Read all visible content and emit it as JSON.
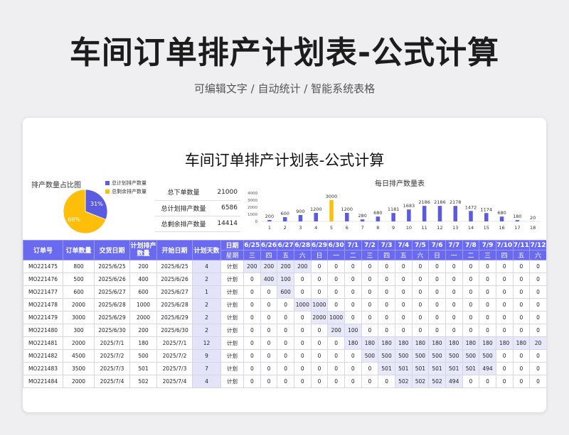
{
  "page": {
    "title": "车间订单排产计划表-公式计算",
    "subtitle": "可编辑文字 / 自动统计 / 智能系统表格"
  },
  "sheet": {
    "title": "车间订单排产计划表-公式计算",
    "pie": {
      "title": "排产数量占比图",
      "slices": [
        {
          "label": "总计划排产数量",
          "percent": "31%",
          "value": 31,
          "color": "#5b5be0"
        },
        {
          "label": "总剩余排产数量",
          "percent": "69%",
          "value": 69,
          "color": "#ffbe0a"
        }
      ]
    },
    "summary": [
      {
        "label": "总下单数量",
        "value": "21000"
      },
      {
        "label": "总计划排产数量",
        "value": "6586"
      },
      {
        "label": "总剩余排产数量",
        "value": "14414"
      }
    ]
  },
  "chart_data": {
    "type": "bar",
    "title": "每日排产数量表",
    "categories": [
      "1",
      "2",
      "3",
      "4",
      "5",
      "6",
      "7",
      "8",
      "9",
      "10",
      "11",
      "12",
      "13",
      "14",
      "15",
      "16",
      "17",
      "18"
    ],
    "values": [
      200,
      600,
      900,
      1200,
      3000,
      1200,
      280,
      680,
      1181,
      1683,
      2186,
      2186,
      2178,
      1472,
      1174,
      680,
      180,
      20
    ],
    "highlight_index": 4,
    "yticks": [
      "4000",
      "3000",
      "2000",
      "1000",
      "0"
    ],
    "ylim": [
      0,
      4000
    ],
    "bar_color": "#5b5be0",
    "highlight_color": "#ffbe0a"
  },
  "table": {
    "headers": {
      "order_no": "订单号",
      "qty": "订单数量",
      "due": "交货日期",
      "plan_qty": "计划排产数量",
      "start": "开始日期",
      "days": "计划天数",
      "date_label": "日期",
      "week_label": "星期"
    },
    "dates": [
      "6/25",
      "6/26",
      "6/27",
      "6/28",
      "6/29",
      "6/30",
      "7/1",
      "7/2",
      "7/3",
      "7/4",
      "7/5",
      "7/6",
      "7/7",
      "7/8",
      "7/9",
      "7/10",
      "7/11",
      "7/12"
    ],
    "weekdays": [
      "三",
      "四",
      "五",
      "六",
      "日",
      "一",
      "二",
      "三",
      "四",
      "五",
      "六",
      "日",
      "一",
      "二",
      "三",
      "四",
      "五",
      "六"
    ],
    "rows": [
      {
        "order": "MO221475",
        "qty": "800",
        "due": "2025/6/25",
        "plan": "200",
        "start": "2025/6/25",
        "days": "4",
        "type": "计划",
        "cells": [
          "200",
          "200",
          "200",
          "200",
          "0",
          "0",
          "0",
          "0",
          "0",
          "0",
          "0",
          "0",
          "0",
          "0",
          "0",
          "0",
          "0",
          "0"
        ]
      },
      {
        "order": "MO221476",
        "qty": "500",
        "due": "2025/6/26",
        "plan": "400",
        "start": "2025/6/26",
        "days": "2",
        "type": "计划",
        "cells": [
          "0",
          "400",
          "100",
          "0",
          "0",
          "0",
          "0",
          "0",
          "0",
          "0",
          "0",
          "0",
          "0",
          "0",
          "0",
          "0",
          "0",
          "0"
        ]
      },
      {
        "order": "MO221477",
        "qty": "600",
        "due": "2025/6/27",
        "plan": "600",
        "start": "2025/6/27",
        "days": "1",
        "type": "计划",
        "cells": [
          "0",
          "0",
          "600",
          "0",
          "0",
          "0",
          "0",
          "0",
          "0",
          "0",
          "0",
          "0",
          "0",
          "0",
          "0",
          "0",
          "0",
          "0"
        ]
      },
      {
        "order": "MO221478",
        "qty": "2000",
        "due": "2025/6/28",
        "plan": "1000",
        "start": "2025/6/28",
        "days": "2",
        "type": "计划",
        "cells": [
          "0",
          "0",
          "0",
          "1000",
          "1000",
          "0",
          "0",
          "0",
          "0",
          "0",
          "0",
          "0",
          "0",
          "0",
          "0",
          "0",
          "0",
          "0"
        ]
      },
      {
        "order": "MO221479",
        "qty": "3000",
        "due": "2025/6/29",
        "plan": "2000",
        "start": "2025/6/29",
        "days": "2",
        "type": "计划",
        "cells": [
          "0",
          "0",
          "0",
          "0",
          "2000",
          "1000",
          "0",
          "0",
          "0",
          "0",
          "0",
          "0",
          "0",
          "0",
          "0",
          "0",
          "0",
          "0"
        ]
      },
      {
        "order": "MO221480",
        "qty": "300",
        "due": "2025/6/30",
        "plan": "200",
        "start": "2025/6/30",
        "days": "2",
        "type": "计划",
        "cells": [
          "0",
          "0",
          "0",
          "0",
          "0",
          "200",
          "100",
          "0",
          "0",
          "0",
          "0",
          "0",
          "0",
          "0",
          "0",
          "0",
          "0",
          "0"
        ]
      },
      {
        "order": "MO221481",
        "qty": "2000",
        "due": "2025/7/1",
        "plan": "180",
        "start": "2025/7/1",
        "days": "12",
        "type": "计划",
        "cells": [
          "0",
          "0",
          "0",
          "0",
          "0",
          "0",
          "180",
          "180",
          "180",
          "180",
          "180",
          "180",
          "180",
          "180",
          "180",
          "180",
          "180",
          "20"
        ]
      },
      {
        "order": "MO221482",
        "qty": "4500",
        "due": "2025/7/2",
        "plan": "500",
        "start": "2025/7/2",
        "days": "9",
        "type": "计划",
        "cells": [
          "0",
          "0",
          "0",
          "0",
          "0",
          "0",
          "0",
          "500",
          "500",
          "500",
          "500",
          "500",
          "500",
          "500",
          "500",
          "0",
          "0",
          "0"
        ]
      },
      {
        "order": "MO221483",
        "qty": "3500",
        "due": "2025/7/3",
        "plan": "501",
        "start": "2025/7/3",
        "days": "7",
        "type": "计划",
        "cells": [
          "0",
          "0",
          "0",
          "0",
          "0",
          "0",
          "0",
          "0",
          "501",
          "501",
          "501",
          "501",
          "501",
          "501",
          "494",
          "0",
          "0",
          "0"
        ]
      },
      {
        "order": "MO221484",
        "qty": "2000",
        "due": "2025/7/4",
        "plan": "502",
        "start": "2025/7/4",
        "days": "4",
        "type": "计划",
        "cells": [
          "0",
          "0",
          "0",
          "0",
          "0",
          "0",
          "0",
          "0",
          "0",
          "502",
          "502",
          "502",
          "494",
          "0",
          "0",
          "0",
          "0",
          "0"
        ]
      }
    ]
  }
}
